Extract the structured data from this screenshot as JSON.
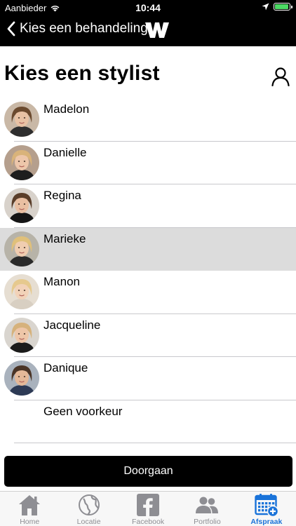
{
  "status_bar": {
    "carrier": "Aanbieder",
    "time": "10:44",
    "battery_level": 0.95,
    "battery_color": "#4cd964"
  },
  "nav": {
    "back_label": "Kies een behandeling",
    "logo_icon": "w-logo-icon"
  },
  "page": {
    "title": "Kies een stylist",
    "profile_icon": "person-icon"
  },
  "stylists": [
    {
      "name": "Madelon",
      "selected": false
    },
    {
      "name": "Danielle",
      "selected": false
    },
    {
      "name": "Regina",
      "selected": false
    },
    {
      "name": "Marieke",
      "selected": true
    },
    {
      "name": "Manon",
      "selected": false
    },
    {
      "name": "Jacqueline",
      "selected": false
    },
    {
      "name": "Danique",
      "selected": false
    },
    {
      "name": "Geen voorkeur",
      "selected": false
    }
  ],
  "continue_label": "Doorgaan",
  "tabs": [
    {
      "label": "Home",
      "icon": "home-icon",
      "active": false
    },
    {
      "label": "Locatie",
      "icon": "globe-icon",
      "active": false
    },
    {
      "label": "Facebook",
      "icon": "facebook-icon",
      "active": false
    },
    {
      "label": "Portfolio",
      "icon": "people-icon",
      "active": false
    },
    {
      "label": "Afspraak",
      "icon": "calendar-add-icon",
      "active": true
    }
  ],
  "colors": {
    "accent": "#1a73d9",
    "selected_row": "#dcdcdc",
    "inactive_tab": "#8e8e93"
  }
}
